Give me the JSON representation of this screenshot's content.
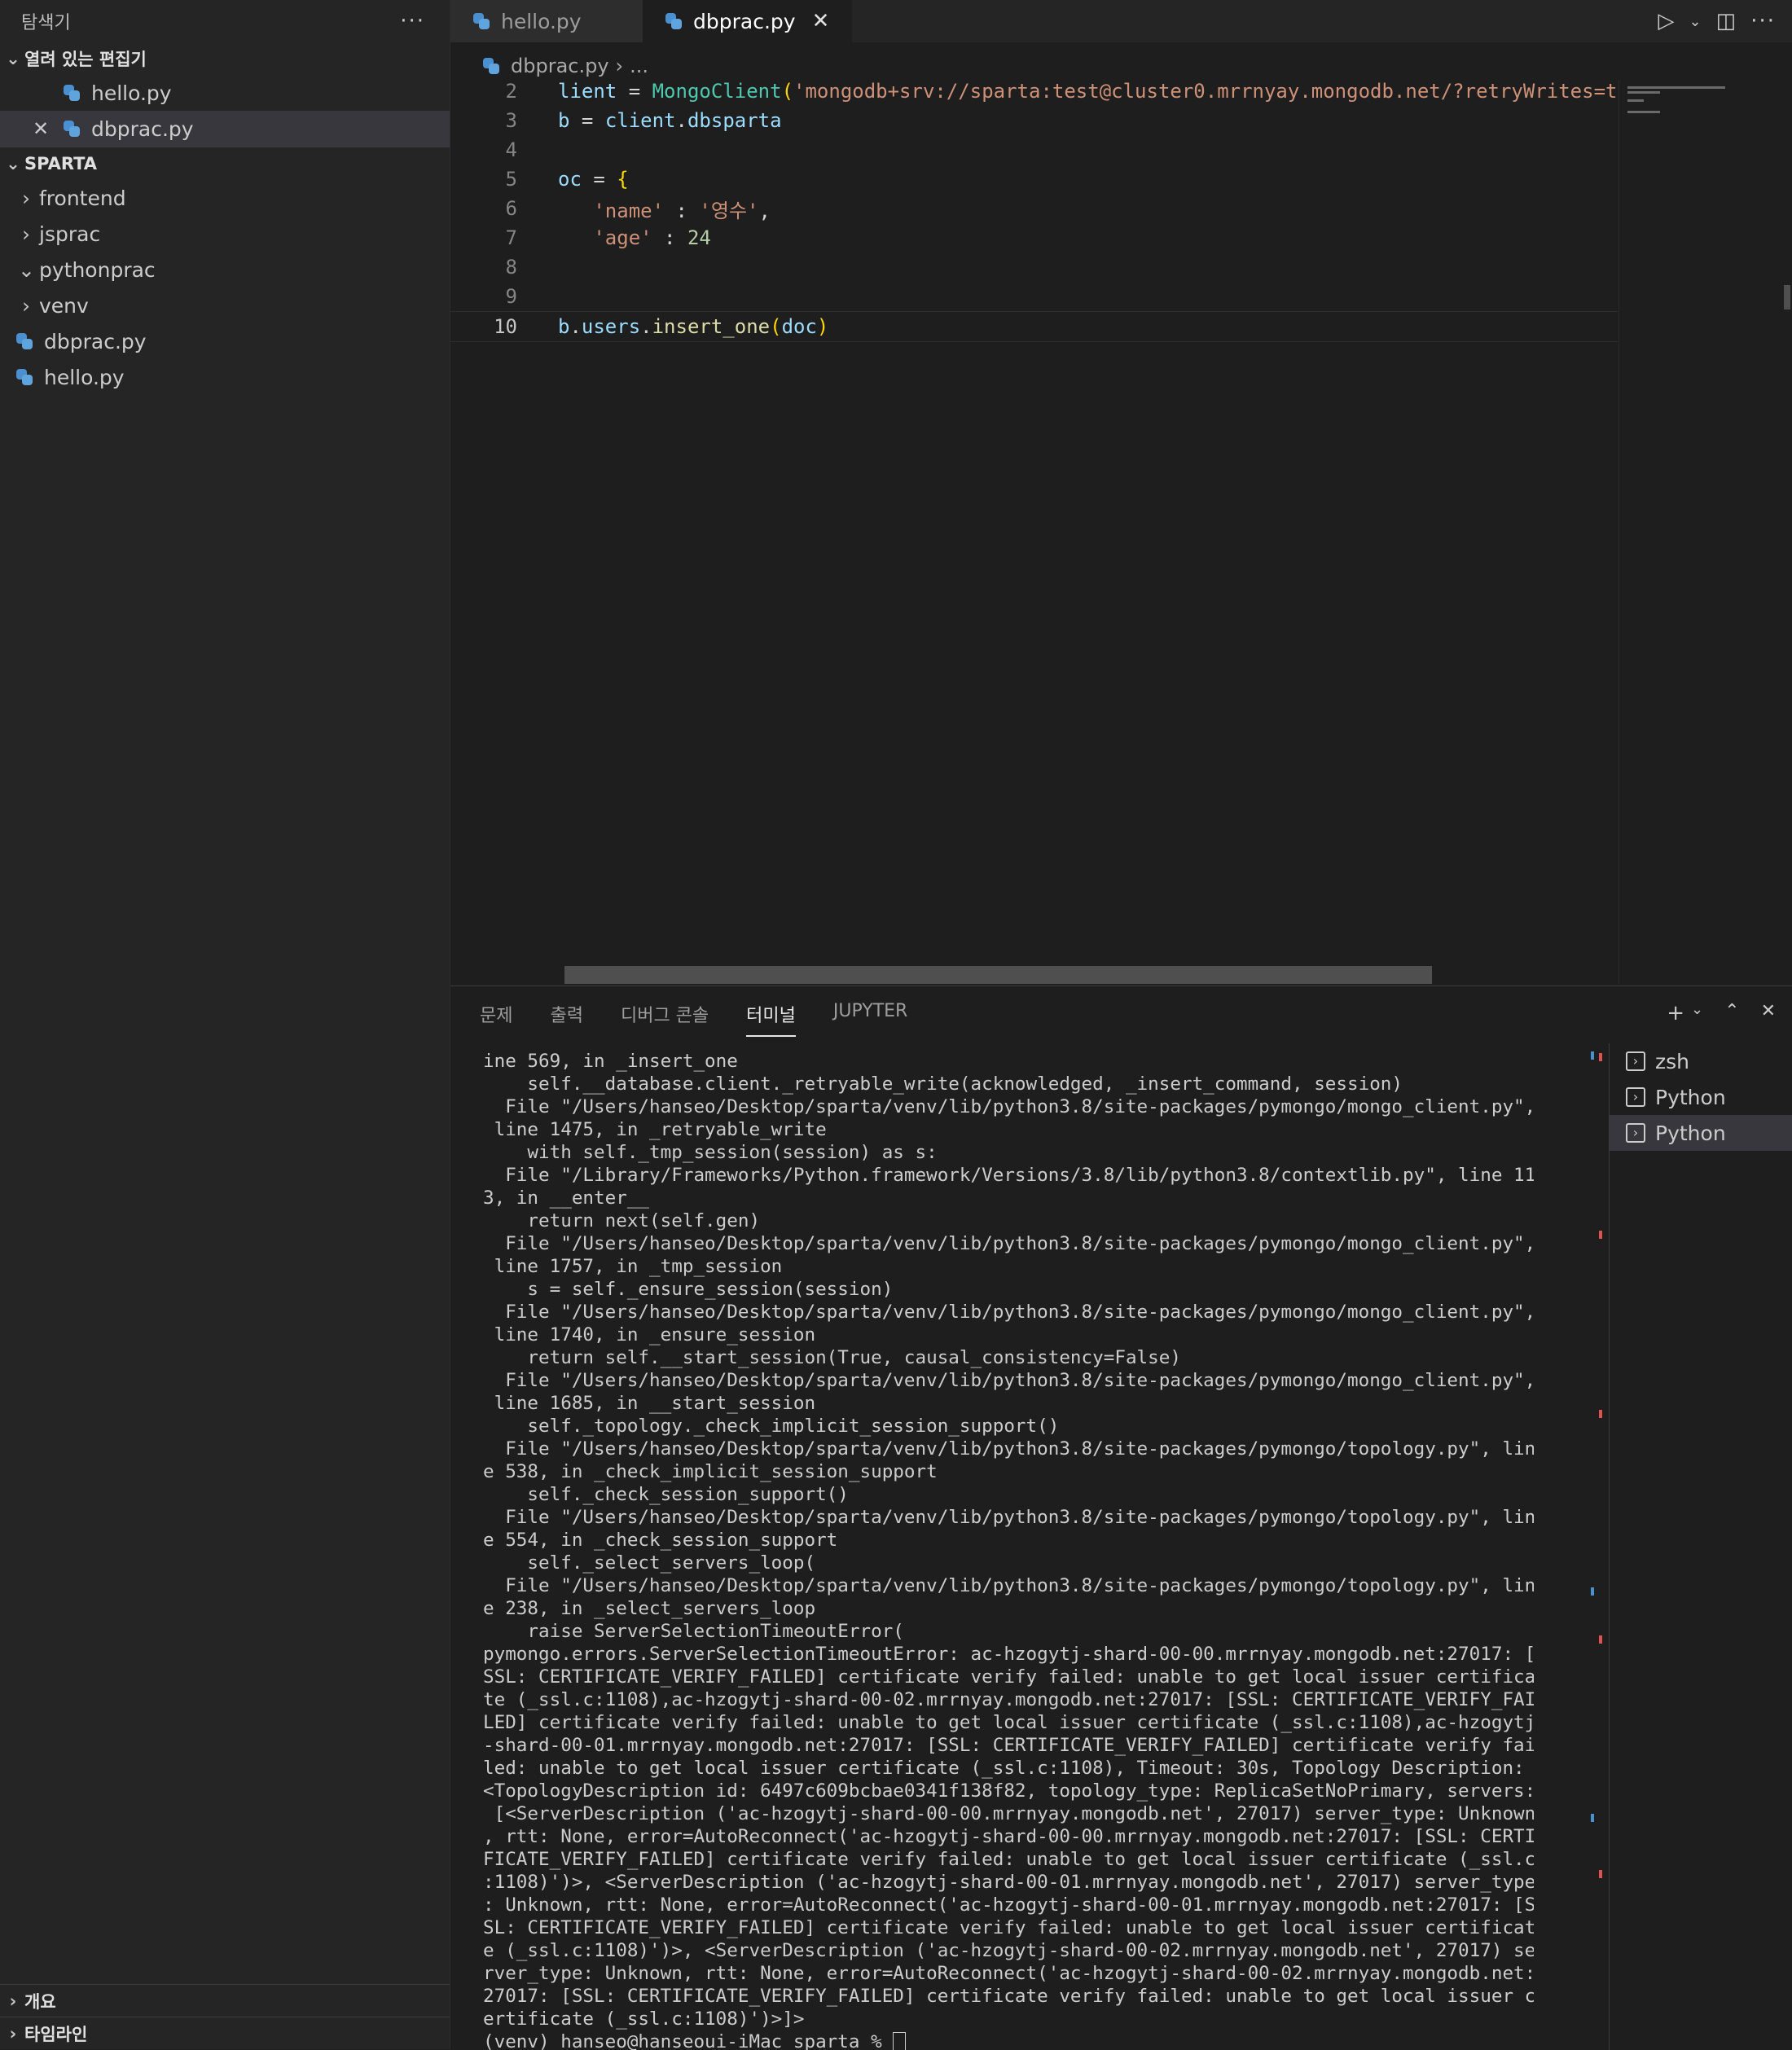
{
  "sidebar": {
    "title": "탐색기",
    "more": "···",
    "open_editors_label": "열려 있는 편집기",
    "open_editors": [
      "hello.py",
      "dbprac.py"
    ],
    "project_label": "SPARTA",
    "tree": [
      {
        "label": "frontend",
        "chevron": "›"
      },
      {
        "label": "jsprac",
        "chevron": "›"
      },
      {
        "label": "pythonprac",
        "chevron": "⌄"
      },
      {
        "label": "venv",
        "chevron": "›"
      },
      {
        "label": "dbprac.py"
      },
      {
        "label": "hello.py"
      }
    ],
    "outline_label": "개요",
    "timeline_label": "타임라인"
  },
  "tabs": [
    {
      "label": "hello.py"
    },
    {
      "label": "dbprac.py"
    }
  ],
  "breadcrumb": {
    "file": "dbprac.py",
    "rest": "..."
  },
  "editor": {
    "lines": [
      {
        "n": "2",
        "tokens": [
          [
            "var",
            "lient"
          ],
          [
            "tx",
            " = "
          ],
          [
            "cls",
            "MongoClient"
          ],
          [
            "br",
            "("
          ],
          [
            "str",
            "'mongodb+srv://sparta:test@cluster0.mrrnyay.mongodb.net/?retryWrites=t"
          ]
        ]
      },
      {
        "n": "3",
        "tokens": [
          [
            "var",
            "b"
          ],
          [
            "tx",
            " = "
          ],
          [
            "var",
            "client"
          ],
          [
            "tx",
            "."
          ],
          [
            "var",
            "dbsparta"
          ]
        ]
      },
      {
        "n": "4",
        "tokens": []
      },
      {
        "n": "5",
        "tokens": [
          [
            "var",
            "oc"
          ],
          [
            "tx",
            " = "
          ],
          [
            "br",
            "{"
          ]
        ]
      },
      {
        "n": "6",
        "tokens": [
          [
            "tx",
            "   "
          ],
          [
            "str",
            "'name'"
          ],
          [
            "tx",
            " : "
          ],
          [
            "str",
            "'영수'"
          ],
          [
            "tx",
            ","
          ]
        ]
      },
      {
        "n": "7",
        "tokens": [
          [
            "tx",
            "   "
          ],
          [
            "str",
            "'age'"
          ],
          [
            "tx",
            " : "
          ],
          [
            "num",
            "24"
          ]
        ]
      },
      {
        "n": "8",
        "tokens": []
      },
      {
        "n": "9",
        "tokens": []
      },
      {
        "n": "10",
        "tokens": [
          [
            "var",
            "b"
          ],
          [
            "tx",
            "."
          ],
          [
            "var",
            "users"
          ],
          [
            "tx",
            "."
          ],
          [
            "fn",
            "insert_one"
          ],
          [
            "br",
            "("
          ],
          [
            "var",
            "doc"
          ],
          [
            "br",
            ")"
          ]
        ]
      }
    ]
  },
  "panel": {
    "tabs": [
      "문제",
      "출력",
      "디버그 콘솔",
      "터미널",
      "JUPYTER"
    ],
    "active_tab": "터미널"
  },
  "terminal": {
    "lines": [
      "ine 569, in _insert_one",
      "    self.__database.client._retryable_write(acknowledged, _insert_command, session)",
      "  File \"/Users/hanseo/Desktop/sparta/venv/lib/python3.8/site-packages/pymongo/mongo_client.py\",",
      " line 1475, in _retryable_write",
      "    with self._tmp_session(session) as s:",
      "  File \"/Library/Frameworks/Python.framework/Versions/3.8/lib/python3.8/contextlib.py\", line 11",
      "3, in __enter__",
      "    return next(self.gen)",
      "  File \"/Users/hanseo/Desktop/sparta/venv/lib/python3.8/site-packages/pymongo/mongo_client.py\",",
      " line 1757, in _tmp_session",
      "    s = self._ensure_session(session)",
      "  File \"/Users/hanseo/Desktop/sparta/venv/lib/python3.8/site-packages/pymongo/mongo_client.py\",",
      " line 1740, in _ensure_session",
      "    return self.__start_session(True, causal_consistency=False)",
      "  File \"/Users/hanseo/Desktop/sparta/venv/lib/python3.8/site-packages/pymongo/mongo_client.py\",",
      " line 1685, in __start_session",
      "    self._topology._check_implicit_session_support()",
      "  File \"/Users/hanseo/Desktop/sparta/venv/lib/python3.8/site-packages/pymongo/topology.py\", lin",
      "e 538, in _check_implicit_session_support",
      "    self._check_session_support()",
      "  File \"/Users/hanseo/Desktop/sparta/venv/lib/python3.8/site-packages/pymongo/topology.py\", lin",
      "e 554, in _check_session_support",
      "    self._select_servers_loop(",
      "  File \"/Users/hanseo/Desktop/sparta/venv/lib/python3.8/site-packages/pymongo/topology.py\", lin",
      "e 238, in _select_servers_loop",
      "    raise ServerSelectionTimeoutError(",
      "pymongo.errors.ServerSelectionTimeoutError: ac-hzogytj-shard-00-00.mrrnyay.mongodb.net:27017: [",
      "SSL: CERTIFICATE_VERIFY_FAILED] certificate verify failed: unable to get local issuer certifica",
      "te (_ssl.c:1108),ac-hzogytj-shard-00-02.mrrnyay.mongodb.net:27017: [SSL: CERTIFICATE_VERIFY_FAI",
      "LED] certificate verify failed: unable to get local issuer certificate (_ssl.c:1108),ac-hzogytj",
      "-shard-00-01.mrrnyay.mongodb.net:27017: [SSL: CERTIFICATE_VERIFY_FAILED] certificate verify fai",
      "led: unable to get local issuer certificate (_ssl.c:1108), Timeout: 30s, Topology Description:",
      "<TopologyDescription id: 6497c609bcbae0341f138f82, topology_type: ReplicaSetNoPrimary, servers:",
      " [<ServerDescription ('ac-hzogytj-shard-00-00.mrrnyay.mongodb.net', 27017) server_type: Unknown",
      ", rtt: None, error=AutoReconnect('ac-hzogytj-shard-00-00.mrrnyay.mongodb.net:27017: [SSL: CERTI",
      "FICATE_VERIFY_FAILED] certificate verify failed: unable to get local issuer certificate (_ssl.c",
      ":1108)')>, <ServerDescription ('ac-hzogytj-shard-00-01.mrrnyay.mongodb.net', 27017) server_type",
      ": Unknown, rtt: None, error=AutoReconnect('ac-hzogytj-shard-00-01.mrrnyay.mongodb.net:27017: [S",
      "SL: CERTIFICATE_VERIFY_FAILED] certificate verify failed: unable to get local issuer certificat",
      "e (_ssl.c:1108)')>, <ServerDescription ('ac-hzogytj-shard-00-02.mrrnyay.mongodb.net', 27017) se",
      "rver_type: Unknown, rtt: None, error=AutoReconnect('ac-hzogytj-shard-00-02.mrrnyay.mongodb.net:",
      "27017: [SSL: CERTIFICATE_VERIFY_FAILED] certificate verify failed: unable to get local issuer c",
      "ertificate (_ssl.c:1108)')>]>"
    ],
    "prompt": "(venv) hanseo@hanseoui-iMac sparta % "
  },
  "terminal_list": [
    "zsh",
    "Python",
    "Python"
  ],
  "icons": {
    "run": "run-icon",
    "split": "split-editor-icon",
    "add": "add-terminal-icon",
    "maximize": "maximize-panel-icon",
    "close": "close-panel-icon"
  }
}
